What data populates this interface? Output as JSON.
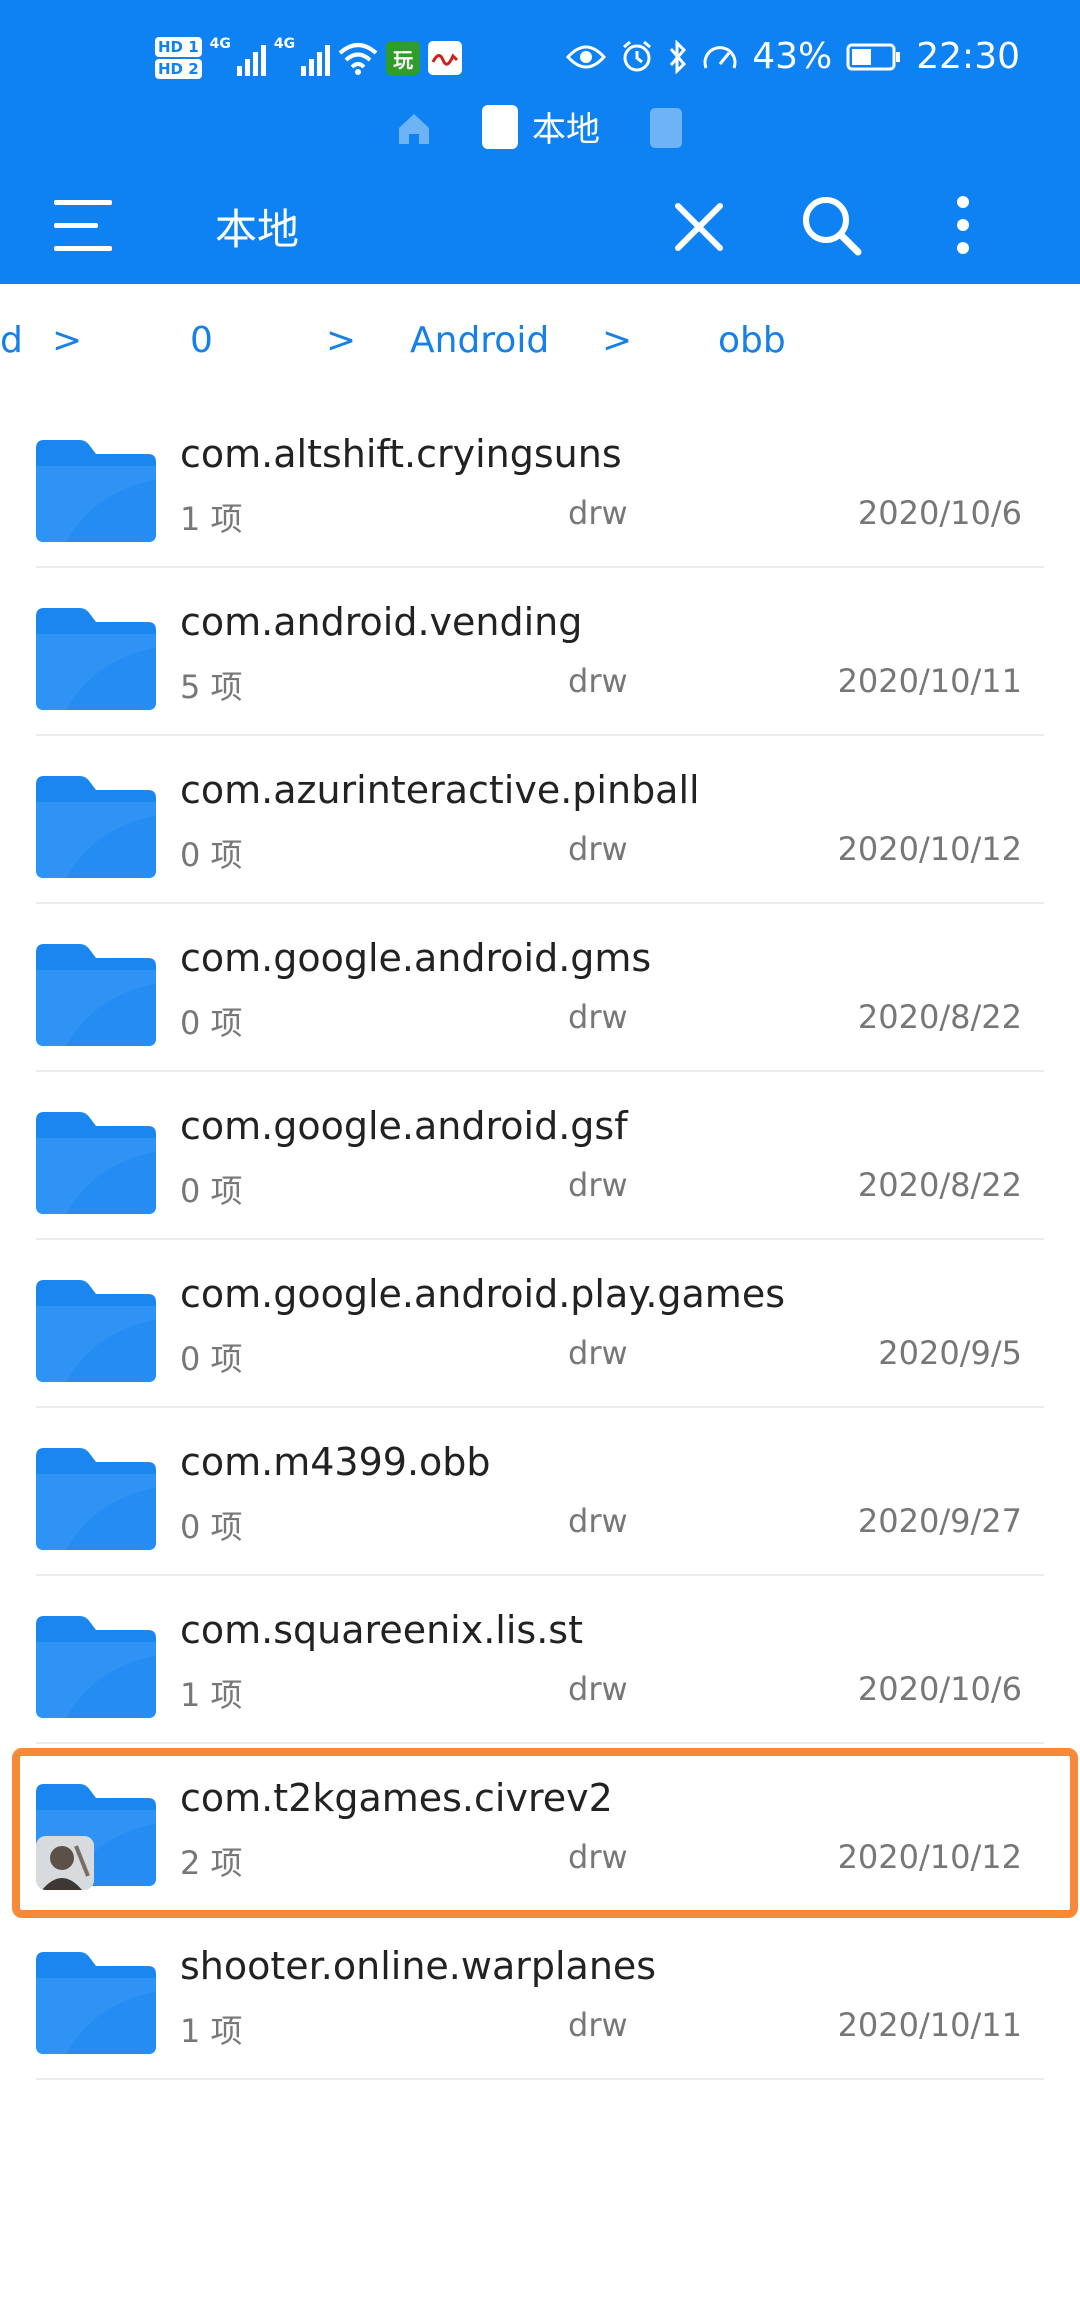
{
  "status_bar": {
    "hd1": "HD 1",
    "hd2": "HD 2",
    "network1": "4G",
    "network2": "4G",
    "app_icon_1": "玩",
    "app_icon_2": "人民日报",
    "battery": "43%",
    "time": "22:30"
  },
  "tabs": {
    "local_label": "本地"
  },
  "toolbar": {
    "title": "本地"
  },
  "breadcrumb": {
    "items": [
      "d",
      "0",
      "Android",
      "obb"
    ],
    "separator": ">"
  },
  "files": [
    {
      "name": "com.altshift.cryingsuns",
      "count": "1 项",
      "perm": "drw",
      "date": "2020/10/6"
    },
    {
      "name": "com.android.vending",
      "count": "5 项",
      "perm": "drw",
      "date": "2020/10/11"
    },
    {
      "name": "com.azurinteractive.pinball",
      "count": "0 项",
      "perm": "drw",
      "date": "2020/10/12"
    },
    {
      "name": "com.google.android.gms",
      "count": "0 项",
      "perm": "drw",
      "date": "2020/8/22"
    },
    {
      "name": "com.google.android.gsf",
      "count": "0 项",
      "perm": "drw",
      "date": "2020/8/22"
    },
    {
      "name": "com.google.android.play.games",
      "count": "0 项",
      "perm": "drw",
      "date": "2020/9/5"
    },
    {
      "name": "com.m4399.obb",
      "count": "0 项",
      "perm": "drw",
      "date": "2020/9/27"
    },
    {
      "name": "com.squareenix.lis.st",
      "count": "1 项",
      "perm": "drw",
      "date": "2020/10/6"
    },
    {
      "name": "com.t2kgames.civrev2",
      "count": "2 项",
      "perm": "drw",
      "date": "2020/10/12"
    },
    {
      "name": "shooter.online.warplanes",
      "count": "1 项",
      "perm": "drw",
      "date": "2020/10/11"
    }
  ],
  "colors": {
    "header": "#0f82f3",
    "folder": "#1a86f0",
    "highlight": "#f7893a",
    "link": "#1580e8"
  }
}
